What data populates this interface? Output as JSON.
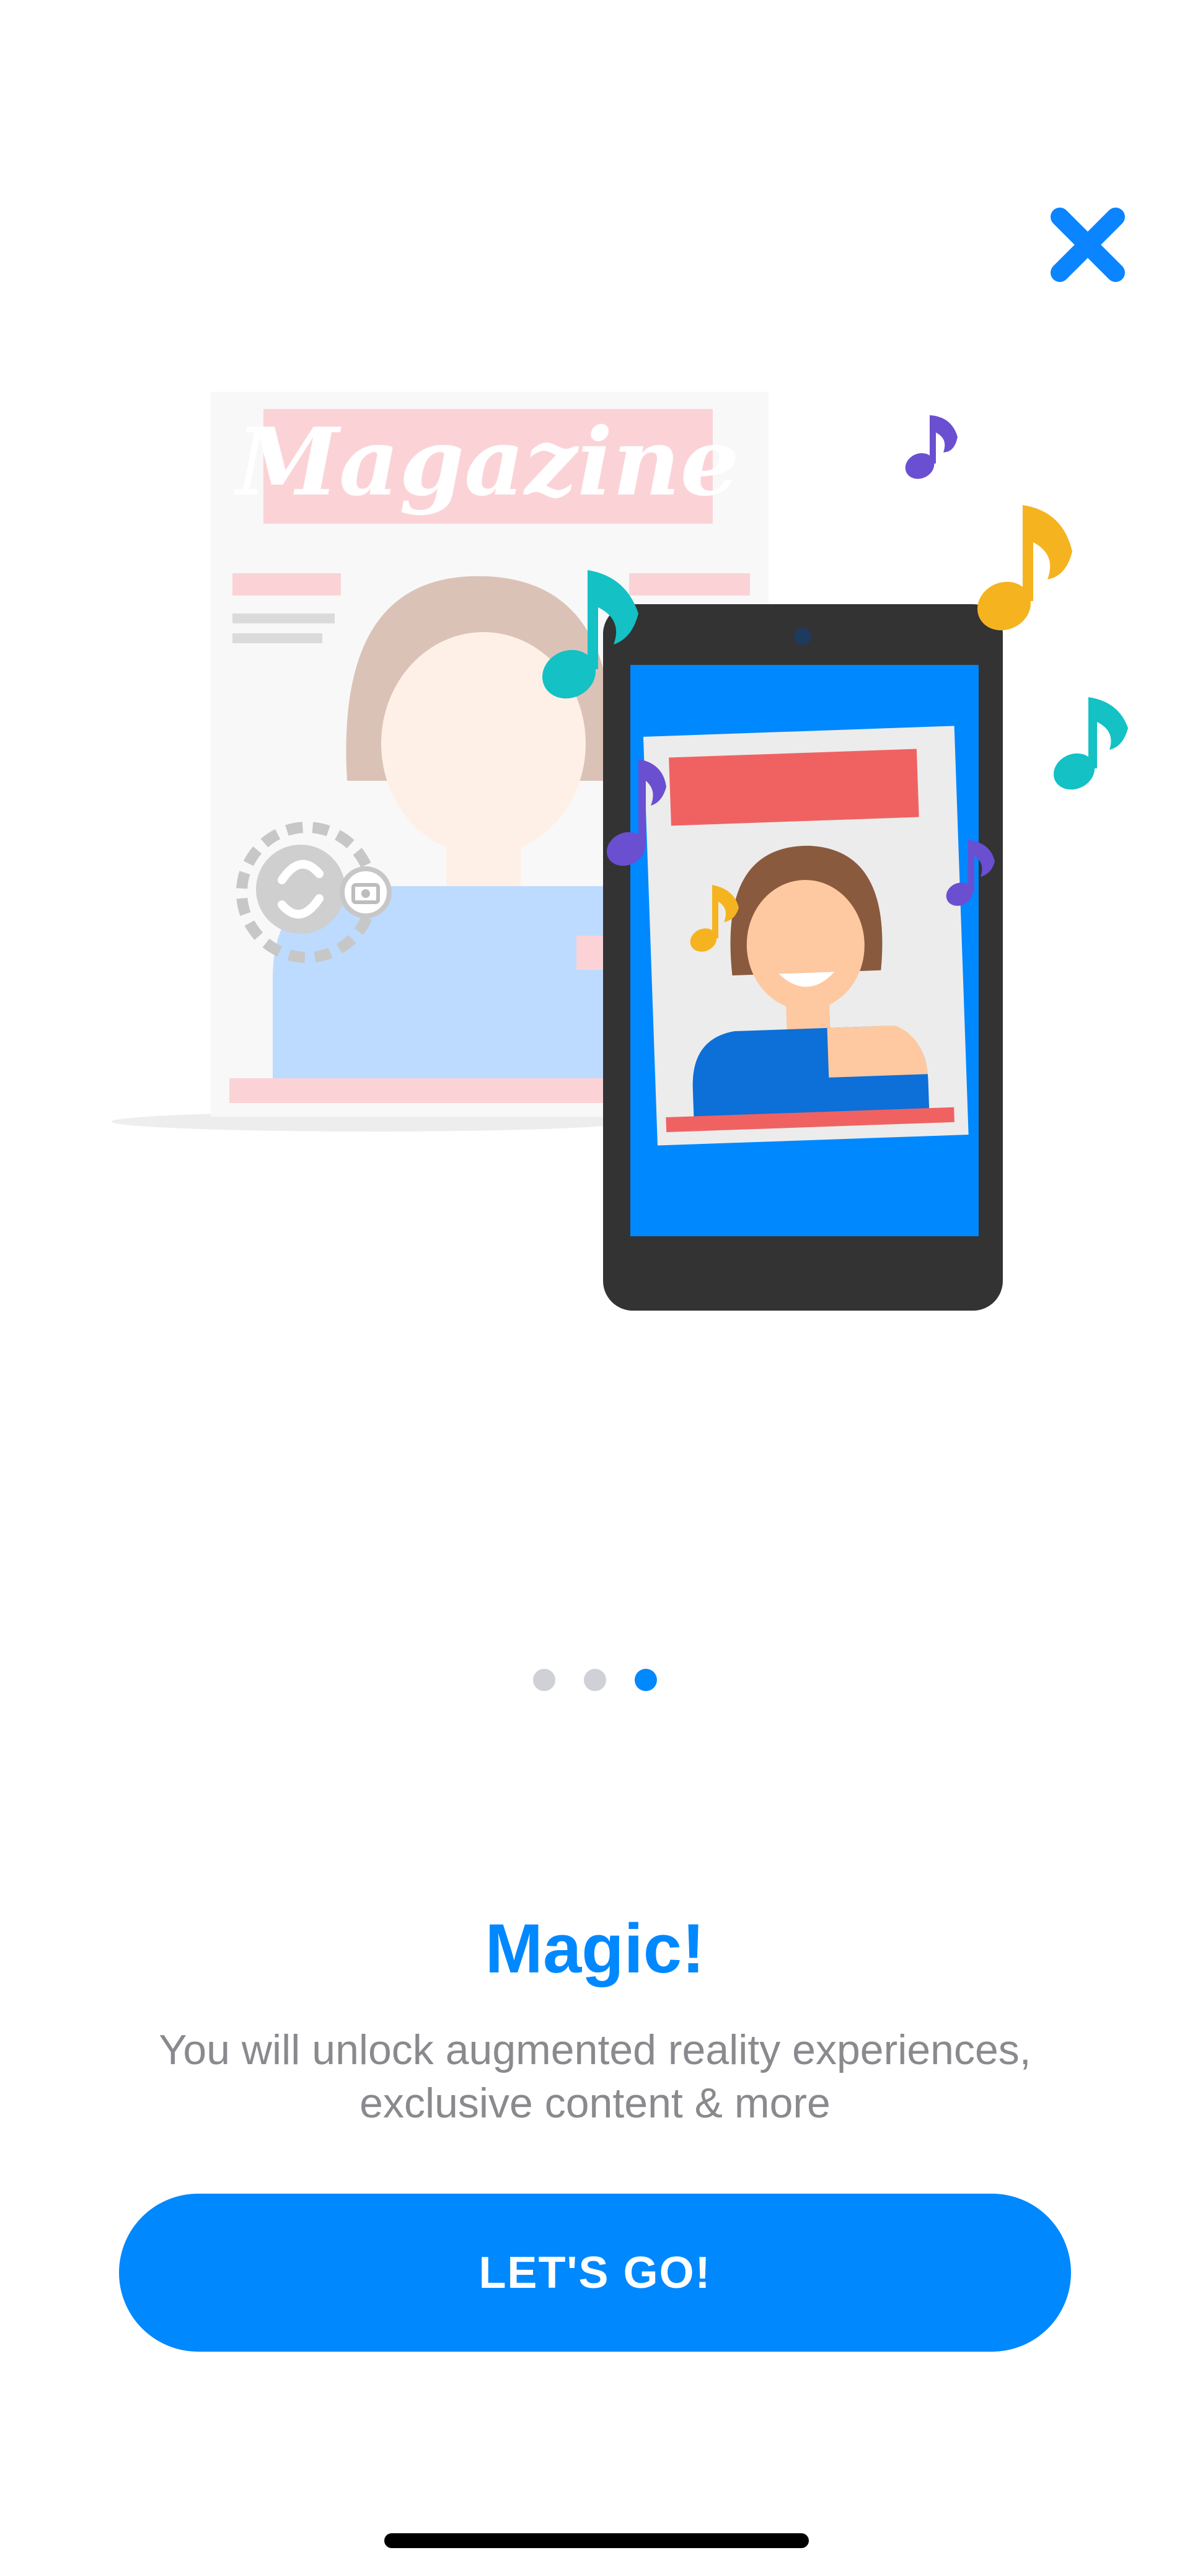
{
  "header": {
    "close_icon": "close-icon"
  },
  "illustration": {
    "magazine_title": "Magazine",
    "scan_icon": "shazam-scan-icon",
    "camera_icon": "camera-icon",
    "note_icon": "music-note-icon"
  },
  "pager": {
    "total": 3,
    "active_index": 2
  },
  "content": {
    "title": "Magic!",
    "subtitle_line1": "You will unlock augmented reality experiences,",
    "subtitle_line2": "exclusive content & more"
  },
  "actions": {
    "cta_label": "LET'S GO!"
  },
  "colors": {
    "accent": "#0088ff",
    "close": "#0a84ff",
    "subtitle": "#8a8a8e",
    "note_teal": "#14c1c4",
    "note_purple": "#6a4fd1",
    "note_yellow": "#f5b320",
    "magazine_red": "#f06262"
  }
}
